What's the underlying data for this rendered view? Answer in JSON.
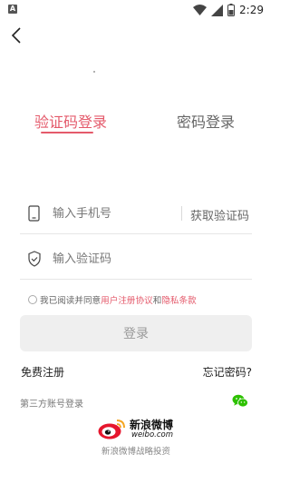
{
  "status_bar": {
    "app_icon_letter": "A",
    "time": "2:29",
    "icons": [
      "wifi-icon",
      "signal-icon",
      "battery-icon"
    ]
  },
  "header": {
    "back_icon": "chevron-left-icon"
  },
  "tabs": [
    {
      "label": "验证码登录",
      "active": true
    },
    {
      "label": "密码登录",
      "active": false
    }
  ],
  "form": {
    "phone_placeholder": "输入手机号",
    "get_code_label": "获取验证码",
    "code_placeholder": "输入验证码"
  },
  "agreement": {
    "prefix": "我已阅读并同意",
    "user_agreement": "用户注册协议",
    "conjunction": "和",
    "privacy_policy": "隐私条款"
  },
  "login_button": "登录",
  "links": {
    "register": "免费注册",
    "forgot_password": "忘记密码?"
  },
  "third_party": {
    "label": "第三方账号登录",
    "providers": [
      "wechat-icon"
    ]
  },
  "footer": {
    "weibo_cn": "新浪微博",
    "weibo_en": "weibo.com",
    "tagline": "新浪微博战略投资"
  },
  "colors": {
    "accent": "#e45a6b",
    "button_bg": "#efefef",
    "wechat": "#2dc100"
  }
}
